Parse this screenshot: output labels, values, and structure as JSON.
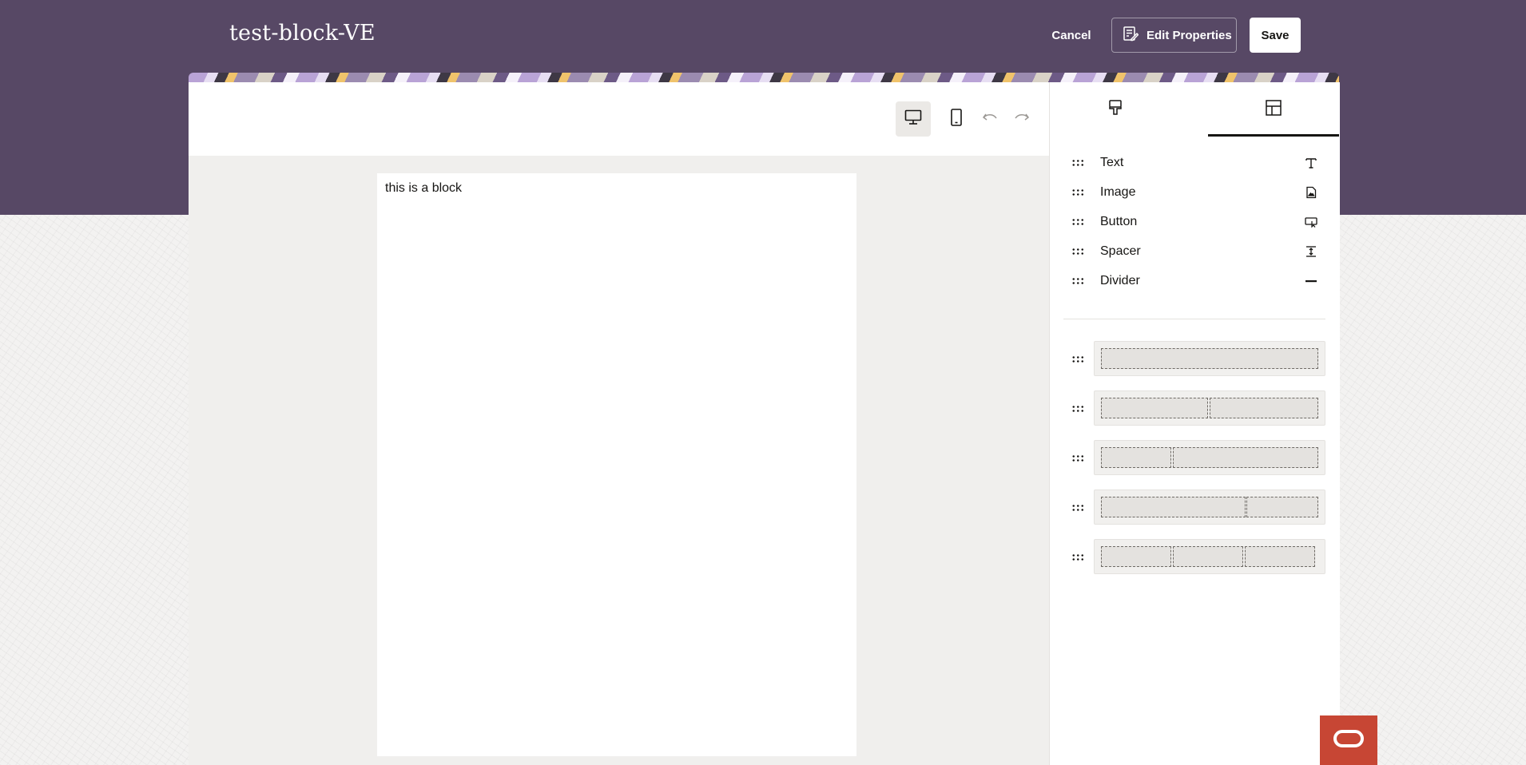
{
  "header": {
    "title": "test-block-VE",
    "cancel_label": "Cancel",
    "edit_properties_label": "Edit Properties",
    "save_label": "Save"
  },
  "toolbar": {
    "desktop_view": "desktop-icon",
    "mobile_view": "mobile-icon",
    "undo": "undo-icon",
    "redo": "redo-icon",
    "active_view": "desktop"
  },
  "canvas": {
    "block_text": "this is a block"
  },
  "side_panel": {
    "tabs": [
      {
        "icon": "paint-brush-icon",
        "active": false
      },
      {
        "icon": "layout-icon",
        "active": true
      }
    ],
    "components": [
      {
        "label": "Text",
        "icon": "text-icon"
      },
      {
        "label": "Image",
        "icon": "image-icon"
      },
      {
        "label": "Button",
        "icon": "button-icon"
      },
      {
        "label": "Spacer",
        "icon": "spacer-icon"
      },
      {
        "label": "Divider",
        "icon": "divider-icon"
      }
    ],
    "layouts": [
      {
        "name": "one-column",
        "columns": [
          1
        ]
      },
      {
        "name": "two-columns-equal",
        "columns": [
          1,
          1
        ]
      },
      {
        "name": "two-columns-narrow-wide",
        "columns": [
          1,
          2
        ]
      },
      {
        "name": "two-columns-wide-narrow",
        "columns": [
          2,
          1
        ]
      },
      {
        "name": "three-columns",
        "columns": [
          1,
          1,
          1
        ]
      }
    ]
  },
  "colors": {
    "header_bg": "#574865",
    "accent_red": "#c74634",
    "text": "#161513"
  }
}
